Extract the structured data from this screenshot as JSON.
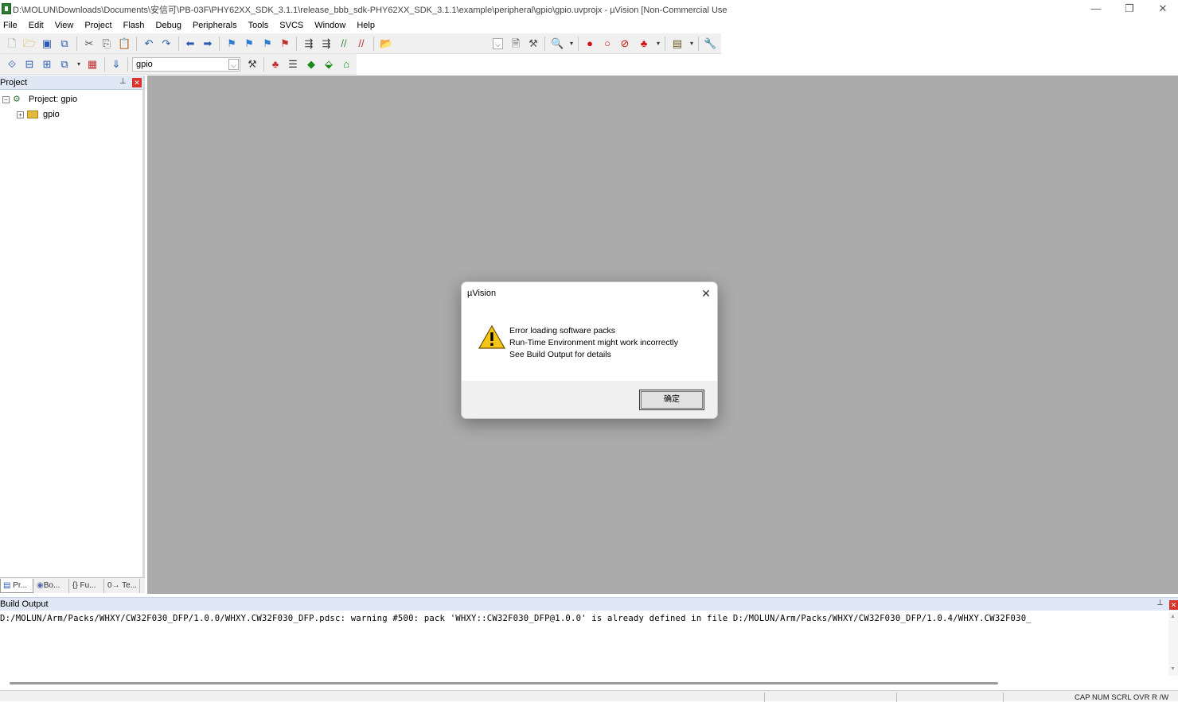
{
  "window": {
    "title": "D:\\MOLUN\\Downloads\\Documents\\安信可\\PB-03F\\PHY62XX_SDK_3.1.1\\release_bbb_sdk-PHY62XX_SDK_3.1.1\\example\\peripheral\\gpio\\gpio.uvprojx - µVision  [Non-Commercial Use",
    "controls": {
      "minimize": "—",
      "restore": "❐",
      "close": "✕"
    }
  },
  "menu": [
    "File",
    "Edit",
    "View",
    "Project",
    "Flash",
    "Debug",
    "Peripherals",
    "Tools",
    "SVCS",
    "Window",
    "Help"
  ],
  "toolbar2": {
    "target_value": "gpio"
  },
  "project_pane": {
    "title": "Project",
    "tree": {
      "root_label": "Project: gpio",
      "child_label": "gpio",
      "root_expander": "−",
      "child_expander": "+"
    },
    "tabs": [
      "Pr...",
      "Bo...",
      "{} Fu...",
      "0→ Te..."
    ]
  },
  "dialog": {
    "title": "µVision",
    "lines": [
      "Error loading software packs",
      "Run-Time Environment might work incorrectly",
      "See Build Output for details"
    ],
    "ok_label": "确定",
    "colors": {
      "warning_fill": "#f5c518",
      "warning_border": "#6b5200"
    }
  },
  "build_output": {
    "title": "Build Output",
    "text": "D:/MOLUN/Arm/Packs/WHXY/CW32F030_DFP/1.0.0/WHXY.CW32F030_DFP.pdsc: warning #500: pack 'WHXY::CW32F030_DFP@1.0.0' is already defined in file D:/MOLUN/Arm/Packs/WHXY/CW32F030_DFP/1.0.4/WHXY.CW32F030_"
  },
  "statusbar": {
    "indicators": "CAP  NUM  SCRL  OVR  R /W"
  }
}
